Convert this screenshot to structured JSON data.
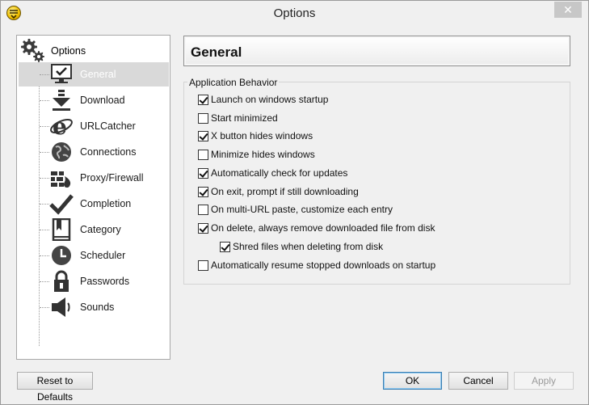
{
  "window": {
    "title": "Options",
    "close_glyph": "✕"
  },
  "tree": {
    "root_label": "Options",
    "items": [
      {
        "label": "General",
        "icon": "monitor-check-icon"
      },
      {
        "label": "Download",
        "icon": "download-arrow-icon"
      },
      {
        "label": "URLCatcher",
        "icon": "ie-logo-icon"
      },
      {
        "label": "Connections",
        "icon": "globe-icon"
      },
      {
        "label": "Proxy/Firewall",
        "icon": "firewall-icon"
      },
      {
        "label": "Completion",
        "icon": "checkmark-icon"
      },
      {
        "label": "Category",
        "icon": "book-icon"
      },
      {
        "label": "Scheduler",
        "icon": "clock-icon"
      },
      {
        "label": "Passwords",
        "icon": "padlock-icon"
      },
      {
        "label": "Sounds",
        "icon": "speaker-icon"
      }
    ],
    "selected": "General"
  },
  "panel": {
    "header": "General",
    "group_title": "Application Behavior",
    "options": [
      {
        "label": "Launch on windows startup",
        "checked": true
      },
      {
        "label": "Start minimized",
        "checked": false
      },
      {
        "label": "X button hides windows",
        "checked": true
      },
      {
        "label": "Minimize hides windows",
        "checked": false
      },
      {
        "label": "Automatically check for updates",
        "checked": true
      },
      {
        "label": "On exit, prompt if still downloading",
        "checked": true
      },
      {
        "label": "On multi-URL paste, customize each entry",
        "checked": false
      },
      {
        "label": "On delete, always remove downloaded file from disk",
        "checked": true
      },
      {
        "label": "Shred files when deleting from disk",
        "checked": true
      },
      {
        "label": "Automatically resume stopped downloads on startup",
        "checked": false
      }
    ]
  },
  "buttons": {
    "reset": "Reset to Defaults",
    "ok": "OK",
    "cancel": "Cancel",
    "apply": "Apply"
  }
}
